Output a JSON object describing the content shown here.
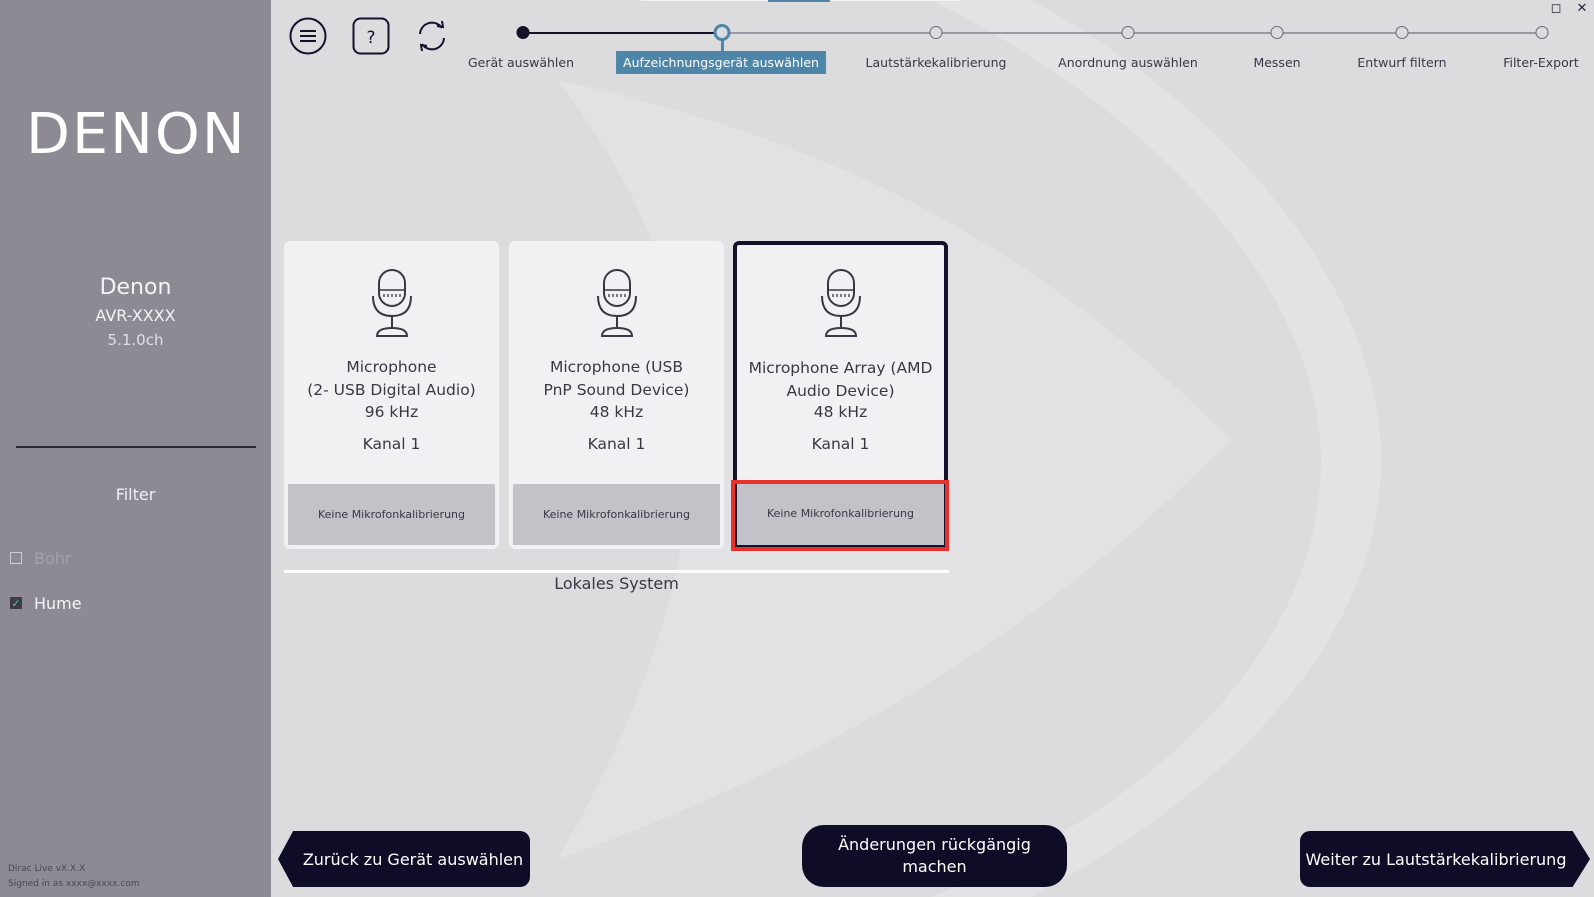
{
  "sidebar": {
    "logo_text": "DENON",
    "device": {
      "brand": "Denon",
      "model": "AVR-XXXX",
      "channels": "5.1.0ch"
    },
    "filter_title": "Filter",
    "filters": [
      {
        "label": "Bohr",
        "checked": false
      },
      {
        "label": "Hume",
        "checked": true
      }
    ],
    "footer": {
      "version": "Dirac Live vX.X.X",
      "signed_in": "Signed in as xxxx@xxxx.com"
    }
  },
  "toolbar": {
    "menu_icon": "hamburger-icon",
    "help_icon": "question-icon",
    "refresh_icon": "refresh-icon",
    "help_glyph": "?"
  },
  "window_controls": {
    "maximize": "◻",
    "close": "✕"
  },
  "stepper": {
    "steps": [
      {
        "label": "Gerät auswählen",
        "state": "done"
      },
      {
        "label": "Aufzeichnungsgerät auswählen",
        "state": "current"
      },
      {
        "label": "Lautstärkekalibrierung",
        "state": "pending"
      },
      {
        "label": "Anordnung auswählen",
        "state": "pending"
      },
      {
        "label": "Messen",
        "state": "pending"
      },
      {
        "label": "Entwurf filtern",
        "state": "pending"
      },
      {
        "label": "Filter-Export",
        "state": "pending"
      }
    ]
  },
  "devices": [
    {
      "name_line1": "Microphone",
      "name_line2": "(2- USB Digital Audio)",
      "rate": "96 kHz",
      "channel": "Kanal 1",
      "calibration": "Keine Mikrofonkalibrierung",
      "selected": false
    },
    {
      "name_line1": "Microphone (USB",
      "name_line2": "PnP Sound Device)",
      "rate": "48 kHz",
      "channel": "Kanal 1",
      "calibration": "Keine Mikrofonkalibrierung",
      "selected": false
    },
    {
      "name_line1": "Microphone Array (AMD",
      "name_line2": "Audio Device)",
      "rate": "48 kHz",
      "channel": "Kanal 1",
      "calibration": "Keine Mikrofonkalibrierung",
      "selected": true
    }
  ],
  "group_label": "Lokales System",
  "nav": {
    "back": "Zurück zu Gerät auswählen",
    "undo": "Änderungen rückgängig machen",
    "next": "Weiter zu Lautstärkekalibrierung"
  },
  "colors": {
    "accent": "#4d86a8",
    "dark": "#0e0c26",
    "highlight": "#e8312c",
    "sidebar": "#8d8a93",
    "background": "#dcdbde"
  }
}
